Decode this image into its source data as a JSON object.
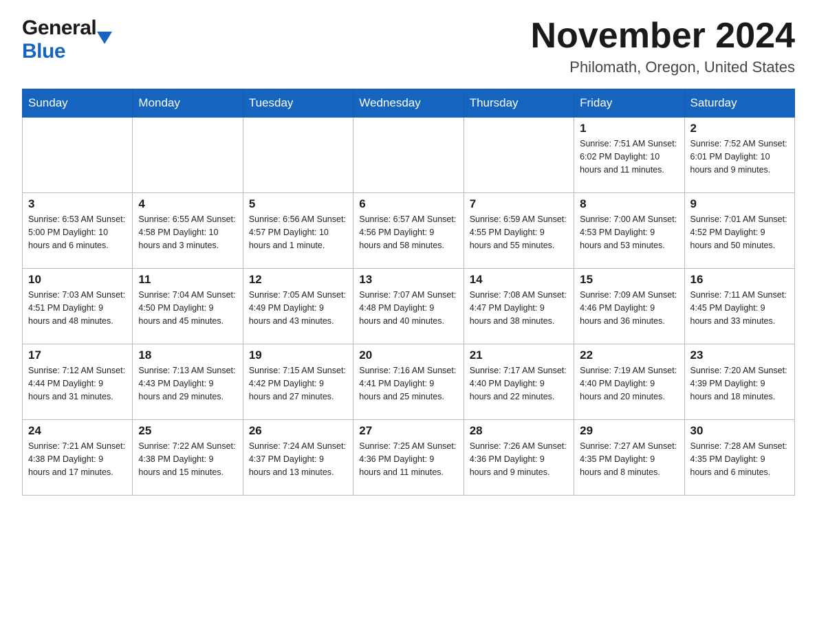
{
  "header": {
    "logo_general": "General",
    "logo_blue": "Blue",
    "month_title": "November 2024",
    "location": "Philomath, Oregon, United States"
  },
  "weekdays": [
    "Sunday",
    "Monday",
    "Tuesday",
    "Wednesday",
    "Thursday",
    "Friday",
    "Saturday"
  ],
  "weeks": [
    [
      {
        "day": "",
        "info": ""
      },
      {
        "day": "",
        "info": ""
      },
      {
        "day": "",
        "info": ""
      },
      {
        "day": "",
        "info": ""
      },
      {
        "day": "",
        "info": ""
      },
      {
        "day": "1",
        "info": "Sunrise: 7:51 AM\nSunset: 6:02 PM\nDaylight: 10 hours\nand 11 minutes."
      },
      {
        "day": "2",
        "info": "Sunrise: 7:52 AM\nSunset: 6:01 PM\nDaylight: 10 hours\nand 9 minutes."
      }
    ],
    [
      {
        "day": "3",
        "info": "Sunrise: 6:53 AM\nSunset: 5:00 PM\nDaylight: 10 hours\nand 6 minutes."
      },
      {
        "day": "4",
        "info": "Sunrise: 6:55 AM\nSunset: 4:58 PM\nDaylight: 10 hours\nand 3 minutes."
      },
      {
        "day": "5",
        "info": "Sunrise: 6:56 AM\nSunset: 4:57 PM\nDaylight: 10 hours\nand 1 minute."
      },
      {
        "day": "6",
        "info": "Sunrise: 6:57 AM\nSunset: 4:56 PM\nDaylight: 9 hours\nand 58 minutes."
      },
      {
        "day": "7",
        "info": "Sunrise: 6:59 AM\nSunset: 4:55 PM\nDaylight: 9 hours\nand 55 minutes."
      },
      {
        "day": "8",
        "info": "Sunrise: 7:00 AM\nSunset: 4:53 PM\nDaylight: 9 hours\nand 53 minutes."
      },
      {
        "day": "9",
        "info": "Sunrise: 7:01 AM\nSunset: 4:52 PM\nDaylight: 9 hours\nand 50 minutes."
      }
    ],
    [
      {
        "day": "10",
        "info": "Sunrise: 7:03 AM\nSunset: 4:51 PM\nDaylight: 9 hours\nand 48 minutes."
      },
      {
        "day": "11",
        "info": "Sunrise: 7:04 AM\nSunset: 4:50 PM\nDaylight: 9 hours\nand 45 minutes."
      },
      {
        "day": "12",
        "info": "Sunrise: 7:05 AM\nSunset: 4:49 PM\nDaylight: 9 hours\nand 43 minutes."
      },
      {
        "day": "13",
        "info": "Sunrise: 7:07 AM\nSunset: 4:48 PM\nDaylight: 9 hours\nand 40 minutes."
      },
      {
        "day": "14",
        "info": "Sunrise: 7:08 AM\nSunset: 4:47 PM\nDaylight: 9 hours\nand 38 minutes."
      },
      {
        "day": "15",
        "info": "Sunrise: 7:09 AM\nSunset: 4:46 PM\nDaylight: 9 hours\nand 36 minutes."
      },
      {
        "day": "16",
        "info": "Sunrise: 7:11 AM\nSunset: 4:45 PM\nDaylight: 9 hours\nand 33 minutes."
      }
    ],
    [
      {
        "day": "17",
        "info": "Sunrise: 7:12 AM\nSunset: 4:44 PM\nDaylight: 9 hours\nand 31 minutes."
      },
      {
        "day": "18",
        "info": "Sunrise: 7:13 AM\nSunset: 4:43 PM\nDaylight: 9 hours\nand 29 minutes."
      },
      {
        "day": "19",
        "info": "Sunrise: 7:15 AM\nSunset: 4:42 PM\nDaylight: 9 hours\nand 27 minutes."
      },
      {
        "day": "20",
        "info": "Sunrise: 7:16 AM\nSunset: 4:41 PM\nDaylight: 9 hours\nand 25 minutes."
      },
      {
        "day": "21",
        "info": "Sunrise: 7:17 AM\nSunset: 4:40 PM\nDaylight: 9 hours\nand 22 minutes."
      },
      {
        "day": "22",
        "info": "Sunrise: 7:19 AM\nSunset: 4:40 PM\nDaylight: 9 hours\nand 20 minutes."
      },
      {
        "day": "23",
        "info": "Sunrise: 7:20 AM\nSunset: 4:39 PM\nDaylight: 9 hours\nand 18 minutes."
      }
    ],
    [
      {
        "day": "24",
        "info": "Sunrise: 7:21 AM\nSunset: 4:38 PM\nDaylight: 9 hours\nand 17 minutes."
      },
      {
        "day": "25",
        "info": "Sunrise: 7:22 AM\nSunset: 4:38 PM\nDaylight: 9 hours\nand 15 minutes."
      },
      {
        "day": "26",
        "info": "Sunrise: 7:24 AM\nSunset: 4:37 PM\nDaylight: 9 hours\nand 13 minutes."
      },
      {
        "day": "27",
        "info": "Sunrise: 7:25 AM\nSunset: 4:36 PM\nDaylight: 9 hours\nand 11 minutes."
      },
      {
        "day": "28",
        "info": "Sunrise: 7:26 AM\nSunset: 4:36 PM\nDaylight: 9 hours\nand 9 minutes."
      },
      {
        "day": "29",
        "info": "Sunrise: 7:27 AM\nSunset: 4:35 PM\nDaylight: 9 hours\nand 8 minutes."
      },
      {
        "day": "30",
        "info": "Sunrise: 7:28 AM\nSunset: 4:35 PM\nDaylight: 9 hours\nand 6 minutes."
      }
    ]
  ]
}
